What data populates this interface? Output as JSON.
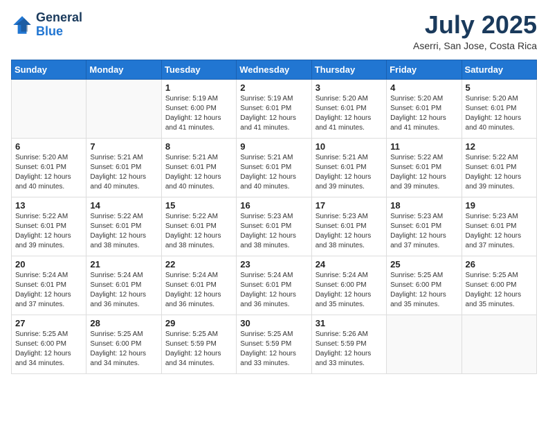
{
  "header": {
    "logo_line1": "General",
    "logo_line2": "Blue",
    "month_year": "July 2025",
    "location": "Aserri, San Jose, Costa Rica"
  },
  "weekdays": [
    "Sunday",
    "Monday",
    "Tuesday",
    "Wednesday",
    "Thursday",
    "Friday",
    "Saturday"
  ],
  "weeks": [
    [
      {
        "day": "",
        "info": ""
      },
      {
        "day": "",
        "info": ""
      },
      {
        "day": "1",
        "info": "Sunrise: 5:19 AM\nSunset: 6:00 PM\nDaylight: 12 hours and 41 minutes."
      },
      {
        "day": "2",
        "info": "Sunrise: 5:19 AM\nSunset: 6:01 PM\nDaylight: 12 hours and 41 minutes."
      },
      {
        "day": "3",
        "info": "Sunrise: 5:20 AM\nSunset: 6:01 PM\nDaylight: 12 hours and 41 minutes."
      },
      {
        "day": "4",
        "info": "Sunrise: 5:20 AM\nSunset: 6:01 PM\nDaylight: 12 hours and 41 minutes."
      },
      {
        "day": "5",
        "info": "Sunrise: 5:20 AM\nSunset: 6:01 PM\nDaylight: 12 hours and 40 minutes."
      }
    ],
    [
      {
        "day": "6",
        "info": "Sunrise: 5:20 AM\nSunset: 6:01 PM\nDaylight: 12 hours and 40 minutes."
      },
      {
        "day": "7",
        "info": "Sunrise: 5:21 AM\nSunset: 6:01 PM\nDaylight: 12 hours and 40 minutes."
      },
      {
        "day": "8",
        "info": "Sunrise: 5:21 AM\nSunset: 6:01 PM\nDaylight: 12 hours and 40 minutes."
      },
      {
        "day": "9",
        "info": "Sunrise: 5:21 AM\nSunset: 6:01 PM\nDaylight: 12 hours and 40 minutes."
      },
      {
        "day": "10",
        "info": "Sunrise: 5:21 AM\nSunset: 6:01 PM\nDaylight: 12 hours and 39 minutes."
      },
      {
        "day": "11",
        "info": "Sunrise: 5:22 AM\nSunset: 6:01 PM\nDaylight: 12 hours and 39 minutes."
      },
      {
        "day": "12",
        "info": "Sunrise: 5:22 AM\nSunset: 6:01 PM\nDaylight: 12 hours and 39 minutes."
      }
    ],
    [
      {
        "day": "13",
        "info": "Sunrise: 5:22 AM\nSunset: 6:01 PM\nDaylight: 12 hours and 39 minutes."
      },
      {
        "day": "14",
        "info": "Sunrise: 5:22 AM\nSunset: 6:01 PM\nDaylight: 12 hours and 38 minutes."
      },
      {
        "day": "15",
        "info": "Sunrise: 5:22 AM\nSunset: 6:01 PM\nDaylight: 12 hours and 38 minutes."
      },
      {
        "day": "16",
        "info": "Sunrise: 5:23 AM\nSunset: 6:01 PM\nDaylight: 12 hours and 38 minutes."
      },
      {
        "day": "17",
        "info": "Sunrise: 5:23 AM\nSunset: 6:01 PM\nDaylight: 12 hours and 38 minutes."
      },
      {
        "day": "18",
        "info": "Sunrise: 5:23 AM\nSunset: 6:01 PM\nDaylight: 12 hours and 37 minutes."
      },
      {
        "day": "19",
        "info": "Sunrise: 5:23 AM\nSunset: 6:01 PM\nDaylight: 12 hours and 37 minutes."
      }
    ],
    [
      {
        "day": "20",
        "info": "Sunrise: 5:24 AM\nSunset: 6:01 PM\nDaylight: 12 hours and 37 minutes."
      },
      {
        "day": "21",
        "info": "Sunrise: 5:24 AM\nSunset: 6:01 PM\nDaylight: 12 hours and 36 minutes."
      },
      {
        "day": "22",
        "info": "Sunrise: 5:24 AM\nSunset: 6:01 PM\nDaylight: 12 hours and 36 minutes."
      },
      {
        "day": "23",
        "info": "Sunrise: 5:24 AM\nSunset: 6:01 PM\nDaylight: 12 hours and 36 minutes."
      },
      {
        "day": "24",
        "info": "Sunrise: 5:24 AM\nSunset: 6:00 PM\nDaylight: 12 hours and 35 minutes."
      },
      {
        "day": "25",
        "info": "Sunrise: 5:25 AM\nSunset: 6:00 PM\nDaylight: 12 hours and 35 minutes."
      },
      {
        "day": "26",
        "info": "Sunrise: 5:25 AM\nSunset: 6:00 PM\nDaylight: 12 hours and 35 minutes."
      }
    ],
    [
      {
        "day": "27",
        "info": "Sunrise: 5:25 AM\nSunset: 6:00 PM\nDaylight: 12 hours and 34 minutes."
      },
      {
        "day": "28",
        "info": "Sunrise: 5:25 AM\nSunset: 6:00 PM\nDaylight: 12 hours and 34 minutes."
      },
      {
        "day": "29",
        "info": "Sunrise: 5:25 AM\nSunset: 5:59 PM\nDaylight: 12 hours and 34 minutes."
      },
      {
        "day": "30",
        "info": "Sunrise: 5:25 AM\nSunset: 5:59 PM\nDaylight: 12 hours and 33 minutes."
      },
      {
        "day": "31",
        "info": "Sunrise: 5:26 AM\nSunset: 5:59 PM\nDaylight: 12 hours and 33 minutes."
      },
      {
        "day": "",
        "info": ""
      },
      {
        "day": "",
        "info": ""
      }
    ]
  ]
}
